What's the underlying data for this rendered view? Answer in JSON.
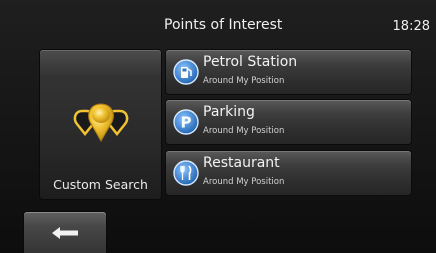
{
  "header": {
    "title": "Points of Interest",
    "time": "18:28"
  },
  "custom_search": {
    "label": "Custom Search",
    "icon": "pin-group-icon"
  },
  "poi_items": [
    {
      "label": "Petrol Station",
      "sub": "Around My Position",
      "icon": "petrol-pump-icon"
    },
    {
      "label": "Parking",
      "sub": "Around My Position",
      "icon": "parking-icon"
    },
    {
      "label": "Restaurant",
      "sub": "Around My Position",
      "icon": "fork-knife-icon"
    }
  ],
  "back_button": {
    "icon": "back-arrow-icon"
  },
  "colors": {
    "icon_blue": "#2a78c6",
    "pin_gold": "#f1c232"
  }
}
